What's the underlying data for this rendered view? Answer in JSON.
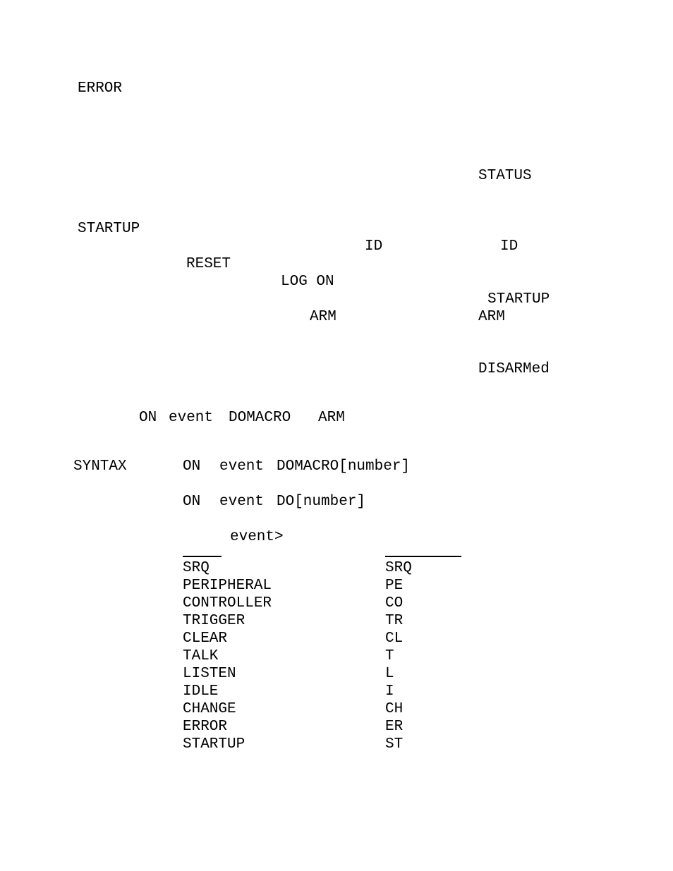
{
  "tokens": {
    "error": "ERROR",
    "status": "STATUS",
    "startup1": "STARTUP",
    "id1": "ID",
    "id2": "ID",
    "reset": "RESET",
    "logon": "LOG ON",
    "startup2": "STARTUP",
    "arm1": "ARM",
    "arm2": "ARM",
    "disarmed": "DISARMed",
    "on1": "ON",
    "event1": "event",
    "domacro1": "DOMACRO",
    "arm3": "ARM",
    "syntax": "SYNTAX",
    "on2": "ON",
    "event2": "event",
    "domacro_num": "DOMACRO[number]",
    "on3": "ON",
    "event3": "event",
    "do_num": "DO[number]",
    "event_gt": "event>"
  },
  "table": {
    "rows": [
      {
        "name": "SRQ",
        "abbrev": "SRQ"
      },
      {
        "name": "PERIPHERAL",
        "abbrev": "PE"
      },
      {
        "name": "CONTROLLER",
        "abbrev": "CO"
      },
      {
        "name": "TRIGGER",
        "abbrev": "TR"
      },
      {
        "name": "CLEAR",
        "abbrev": "CL"
      },
      {
        "name": "TALK",
        "abbrev": "T"
      },
      {
        "name": "LISTEN",
        "abbrev": "L"
      },
      {
        "name": "IDLE",
        "abbrev": "I"
      },
      {
        "name": "CHANGE",
        "abbrev": "CH"
      },
      {
        "name": "ERROR",
        "abbrev": "ER"
      },
      {
        "name": "STARTUP",
        "abbrev": "ST"
      }
    ]
  }
}
